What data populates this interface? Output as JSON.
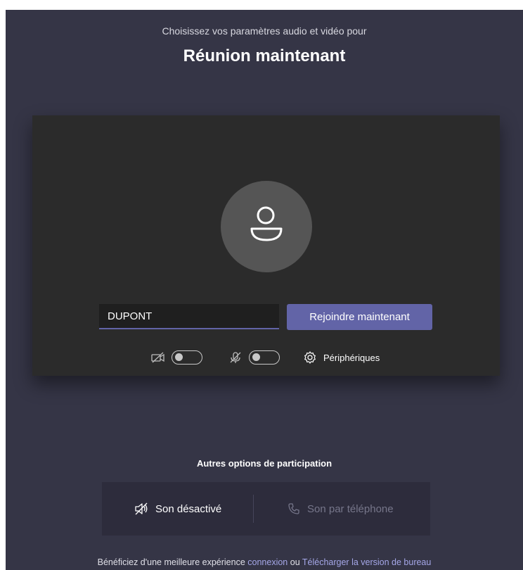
{
  "header": {
    "subtitle": "Choisissez vos paramètres audio et vidéo pour",
    "title": "Réunion maintenant"
  },
  "preview": {
    "name_value": "DUPONT",
    "join_label": "Rejoindre maintenant",
    "camera_toggle": "off",
    "mic_toggle": "off",
    "devices_label": "Périphériques"
  },
  "other_options": {
    "title": "Autres options de participation",
    "mute_label": "Son désactivé",
    "phone_label": "Son par téléphone"
  },
  "footer": {
    "prefix": "Bénéficiez d'une meilleure expérience ",
    "login_link": "connexion",
    "middle": " ou ",
    "download_link": "Télécharger la version de bureau"
  },
  "colors": {
    "background": "#353546",
    "panel": "#2b2b2b",
    "accent": "#6264a7",
    "link": "#a5a7e8"
  }
}
